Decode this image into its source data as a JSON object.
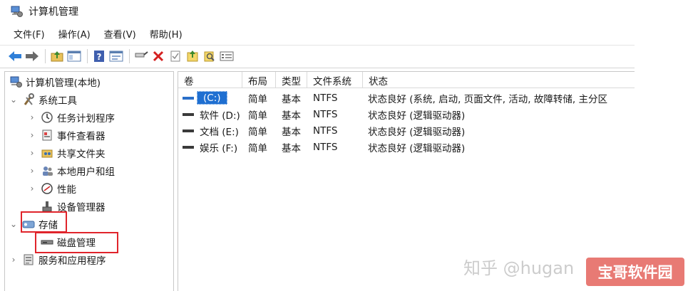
{
  "window": {
    "title": "计算机管理"
  },
  "menu": [
    "文件(F)",
    "操作(A)",
    "查看(V)",
    "帮助(H)"
  ],
  "toolbar": {
    "buttons": [
      "back-arrow-icon",
      "forward-arrow-icon",
      "up-folder-icon",
      "show-hide-tree-icon",
      "help-icon",
      "properties-icon",
      "connect-icon",
      "delete-icon",
      "checklist-icon",
      "import-icon",
      "search-icon",
      "export-icon"
    ]
  },
  "tree": {
    "root": "计算机管理(本地)",
    "system_tools": "系统工具",
    "task_scheduler": "任务计划程序",
    "event_viewer": "事件查看器",
    "shared_folders": "共享文件夹",
    "local_users": "本地用户和组",
    "performance": "性能",
    "device_manager": "设备管理器",
    "storage": "存储",
    "disk_management": "磁盘管理",
    "services_apps": "服务和应用程序"
  },
  "volume_table": {
    "columns": [
      "卷",
      "布局",
      "类型",
      "文件系统",
      "状态"
    ],
    "rows": [
      {
        "volume": "(C:)",
        "layout": "简单",
        "type": "基本",
        "fs": "NTFS",
        "status": "状态良好 (系统, 启动, 页面文件, 活动, 故障转储, 主分区"
      },
      {
        "volume": "软件 (D:)",
        "layout": "简单",
        "type": "基本",
        "fs": "NTFS",
        "status": "状态良好 (逻辑驱动器)"
      },
      {
        "volume": "文档 (E:)",
        "layout": "简单",
        "type": "基本",
        "fs": "NTFS",
        "status": "状态良好 (逻辑驱动器)"
      },
      {
        "volume": "娱乐 (F:)",
        "layout": "简单",
        "type": "基本",
        "fs": "NTFS",
        "status": "状态良好 (逻辑驱动器)"
      }
    ]
  },
  "watermark": {
    "text": "知乎 @hugan",
    "badge": "宝哥软件园"
  },
  "colors": {
    "highlight_box": "#e0242b",
    "selection": "#1f6fd1",
    "badge": "#e87a74"
  }
}
